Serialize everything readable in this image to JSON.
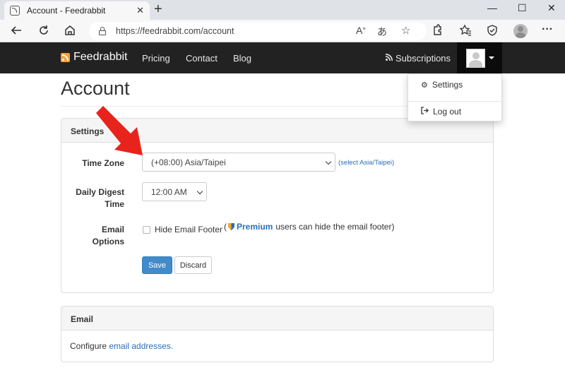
{
  "browser": {
    "tab_title": "Account - Feedrabbit",
    "tab_close": "✕",
    "new_tab": "+",
    "url": "https://feedrabbit.com/account",
    "window_controls": [
      "—",
      "☐",
      "✕"
    ]
  },
  "navbar": {
    "brand": "Feedrabbit",
    "links": [
      "Pricing",
      "Contact",
      "Blog"
    ],
    "subscriptions": "Subscriptions"
  },
  "dropdown": {
    "items": [
      {
        "label": "Settings",
        "icon": "gear-icon"
      },
      {
        "label": "Log out",
        "icon": "logout-icon"
      }
    ]
  },
  "page": {
    "title": "Account"
  },
  "settings": {
    "heading": "Settings",
    "time_zone_label": "Time Zone",
    "time_zone_value": "(+08:00) Asia/Taipei",
    "time_zone_link": "(select Asia/Taipei)",
    "digest_label": "Daily Digest Time",
    "digest_value": "12:00 AM",
    "email_options_label": "Email Options",
    "hide_footer_label": "Hide Email Footer",
    "premium_open": "(",
    "premium_link": "Premium",
    "premium_rest": "users can hide the email footer)",
    "save_button": "Save",
    "discard_button": "Discard"
  },
  "email": {
    "heading": "Email",
    "text": "Configure ",
    "link": "email addresses."
  },
  "colors": {
    "navbar_bg": "#222222",
    "primary": "#428bca",
    "link": "#2a6fb5",
    "rss_orange": "#f5a03a",
    "annotation_red": "#e8231c"
  }
}
